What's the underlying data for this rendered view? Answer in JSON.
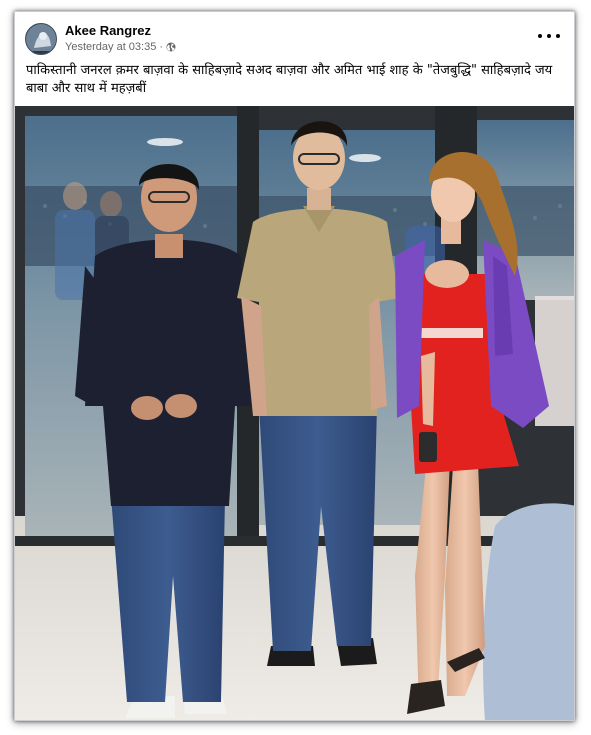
{
  "post": {
    "author": "Akee Rangrez",
    "timestamp": "Yesterday at 03:35",
    "separator": "·",
    "privacy_icon": "globe-icon",
    "more_icon": "more-options-icon",
    "text": "पाकिस्तानी जनरल क़मर बाज़वा के साहिबज़ादे सअद बाज़वा और अमित भाई शाह के \"तेजबुद्धि\" साहिबज़ादे जय बाबा और साथ में महज़बीं"
  },
  "photo": {
    "description_icon": "photo",
    "colors": {
      "accent_dress": "#e2221f",
      "jacket": "#7b4bc4",
      "polo": "#b9a67a",
      "shirt": "#1c2030"
    }
  }
}
